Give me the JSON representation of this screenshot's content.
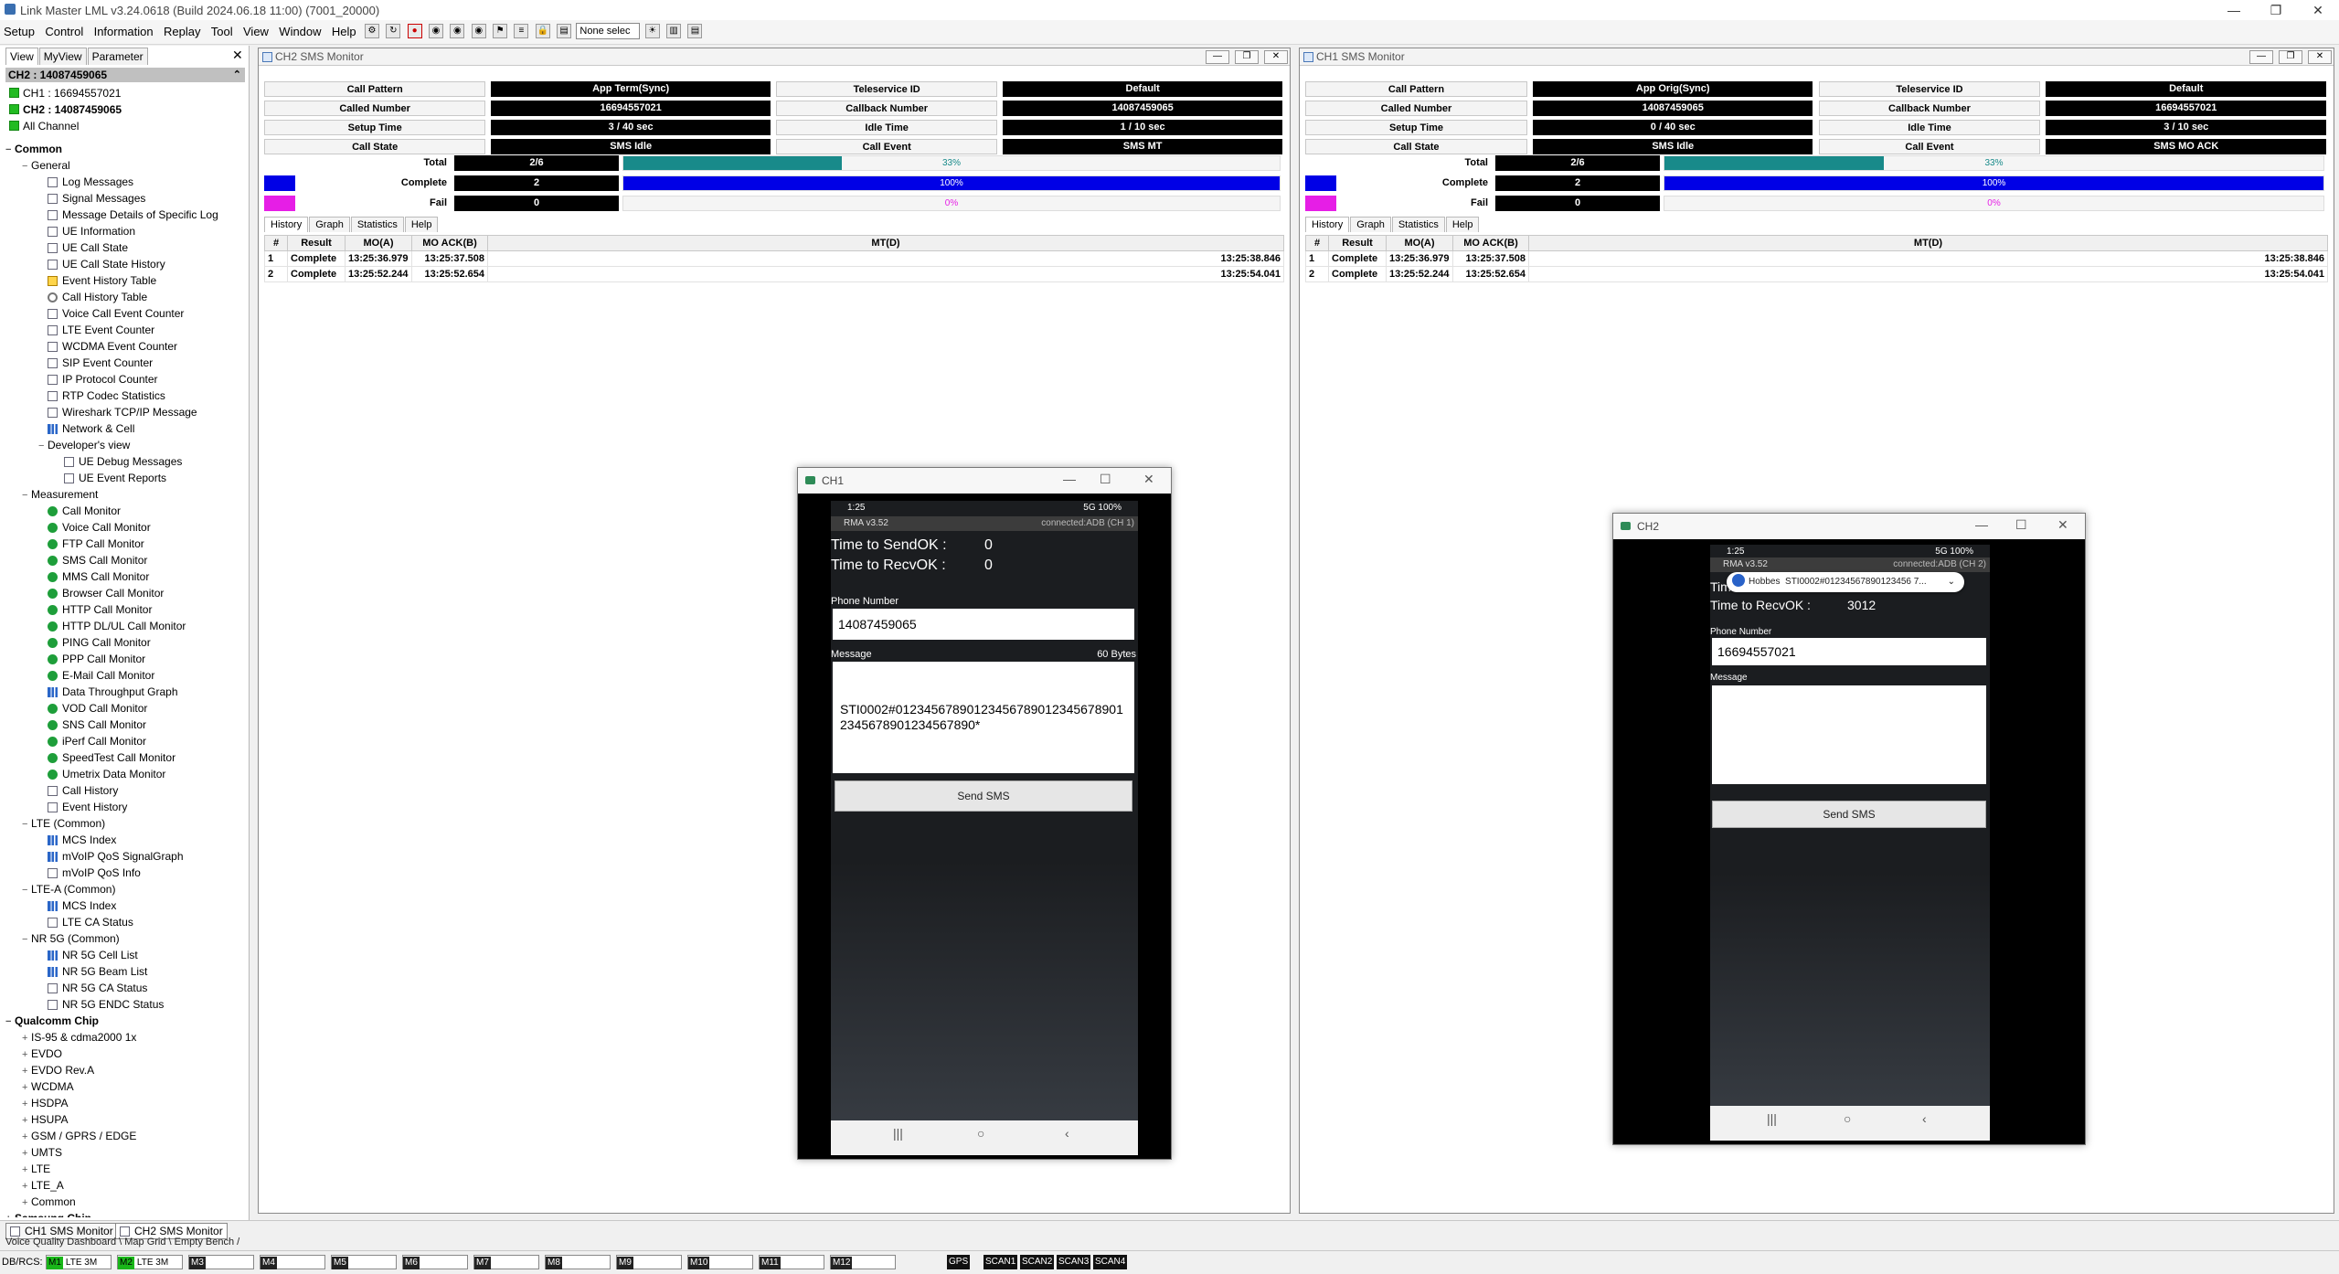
{
  "app": {
    "title": "Link Master LML v3.24.0618 (Build 2024.06.18 11:00) (7001_20000)"
  },
  "menu": [
    "Setup",
    "Control",
    "Information",
    "Replay",
    "Tool",
    "View",
    "Window",
    "Help"
  ],
  "toolbar": {
    "select_value": "None selec"
  },
  "left": {
    "tabs": [
      "View",
      "MyView",
      "Parameter"
    ],
    "close": "✕",
    "channel_header": "CH2 : 14087459065",
    "channels": [
      "CH1 : 16694557021",
      "CH2 : 14087459065",
      "All Channel"
    ]
  },
  "tree": [
    {
      "label": "Common",
      "level": 0,
      "exp": "−",
      "bold": true,
      "icon": "none"
    },
    {
      "label": "General",
      "level": 1,
      "exp": "−",
      "icon": "none"
    },
    {
      "label": "Log Messages",
      "level": 2,
      "icon": "doc"
    },
    {
      "label": "Signal Messages",
      "level": 2,
      "icon": "doc"
    },
    {
      "label": "Message Details of Specific Log",
      "level": 2,
      "icon": "doc"
    },
    {
      "label": "UE Information",
      "level": 2,
      "icon": "doc"
    },
    {
      "label": "UE Call State",
      "level": 2,
      "icon": "doc"
    },
    {
      "label": "UE Call State History",
      "level": 2,
      "icon": "doc"
    },
    {
      "label": "Event History Table",
      "level": 2,
      "icon": "warn"
    },
    {
      "label": "Call History Table",
      "level": 2,
      "icon": "gear"
    },
    {
      "label": "Voice Call Event Counter",
      "level": 2,
      "icon": "doc"
    },
    {
      "label": "LTE Event Counter",
      "level": 2,
      "icon": "doc"
    },
    {
      "label": "WCDMA Event Counter",
      "level": 2,
      "icon": "doc"
    },
    {
      "label": "SIP Event Counter",
      "level": 2,
      "icon": "doc"
    },
    {
      "label": "IP Protocol Counter",
      "level": 2,
      "icon": "doc"
    },
    {
      "label": "RTP Codec Statistics",
      "level": 2,
      "icon": "doc"
    },
    {
      "label": "Wireshark TCP/IP Message",
      "level": 2,
      "icon": "doc"
    },
    {
      "label": "Network & Cell",
      "level": 2,
      "icon": "chart"
    },
    {
      "label": "Developer's view",
      "level": 2,
      "exp": "−",
      "icon": "none"
    },
    {
      "label": "UE Debug Messages",
      "level": 3,
      "icon": "doc"
    },
    {
      "label": "UE Event Reports",
      "level": 3,
      "icon": "doc"
    },
    {
      "label": "Measurement",
      "level": 1,
      "exp": "−",
      "icon": "none"
    },
    {
      "label": "Call Monitor",
      "level": 2,
      "icon": "green"
    },
    {
      "label": "Voice Call Monitor",
      "level": 2,
      "icon": "green"
    },
    {
      "label": "FTP Call Monitor",
      "level": 2,
      "icon": "green"
    },
    {
      "label": "SMS Call Monitor",
      "level": 2,
      "icon": "green"
    },
    {
      "label": "MMS Call Monitor",
      "level": 2,
      "icon": "green"
    },
    {
      "label": "Browser Call Monitor",
      "level": 2,
      "icon": "green"
    },
    {
      "label": "HTTP Call Monitor",
      "level": 2,
      "icon": "green"
    },
    {
      "label": "HTTP DL/UL Call Monitor",
      "level": 2,
      "icon": "green"
    },
    {
      "label": "PING Call Monitor",
      "level": 2,
      "icon": "green"
    },
    {
      "label": "PPP Call Monitor",
      "level": 2,
      "icon": "green"
    },
    {
      "label": "E-Mail Call Monitor",
      "level": 2,
      "icon": "green"
    },
    {
      "label": "Data Throughput Graph",
      "level": 2,
      "icon": "chart"
    },
    {
      "label": "VOD Call Monitor",
      "level": 2,
      "icon": "green"
    },
    {
      "label": "SNS Call Monitor",
      "level": 2,
      "icon": "green"
    },
    {
      "label": "iPerf Call Monitor",
      "level": 2,
      "icon": "green"
    },
    {
      "label": "SpeedTest Call Monitor",
      "level": 2,
      "icon": "green"
    },
    {
      "label": "Umetrix Data Monitor",
      "level": 2,
      "icon": "green"
    },
    {
      "label": "Call History",
      "level": 2,
      "icon": "doc"
    },
    {
      "label": "Event History",
      "level": 2,
      "icon": "doc"
    },
    {
      "label": "LTE (Common)",
      "level": 1,
      "exp": "−",
      "icon": "none"
    },
    {
      "label": "MCS Index",
      "level": 2,
      "icon": "chart"
    },
    {
      "label": "mVoIP QoS SignalGraph",
      "level": 2,
      "icon": "chart"
    },
    {
      "label": "mVoIP QoS Info",
      "level": 2,
      "icon": "doc"
    },
    {
      "label": "LTE-A (Common)",
      "level": 1,
      "exp": "−",
      "icon": "none"
    },
    {
      "label": "MCS Index",
      "level": 2,
      "icon": "chart"
    },
    {
      "label": "LTE CA Status",
      "level": 2,
      "icon": "doc"
    },
    {
      "label": "NR 5G (Common)",
      "level": 1,
      "exp": "−",
      "icon": "none"
    },
    {
      "label": "NR 5G Cell List",
      "level": 2,
      "icon": "chart"
    },
    {
      "label": "NR 5G Beam List",
      "level": 2,
      "icon": "chart"
    },
    {
      "label": "NR 5G CA Status",
      "level": 2,
      "icon": "doc"
    },
    {
      "label": "NR 5G ENDC Status",
      "level": 2,
      "icon": "doc"
    },
    {
      "label": "Qualcomm Chip",
      "level": 0,
      "exp": "−",
      "bold": true,
      "icon": "none"
    },
    {
      "label": "IS-95 & cdma2000 1x",
      "level": 1,
      "exp": "+",
      "icon": "none"
    },
    {
      "label": "EVDO",
      "level": 1,
      "exp": "+",
      "icon": "none"
    },
    {
      "label": "EVDO Rev.A",
      "level": 1,
      "exp": "+",
      "icon": "none"
    },
    {
      "label": "WCDMA",
      "level": 1,
      "exp": "+",
      "icon": "none"
    },
    {
      "label": "HSDPA",
      "level": 1,
      "exp": "+",
      "icon": "none"
    },
    {
      "label": "HSUPA",
      "level": 1,
      "exp": "+",
      "icon": "none"
    },
    {
      "label": "GSM / GPRS / EDGE",
      "level": 1,
      "exp": "+",
      "icon": "none"
    },
    {
      "label": "UMTS",
      "level": 1,
      "exp": "+",
      "icon": "none"
    },
    {
      "label": "LTE",
      "level": 1,
      "exp": "+",
      "icon": "none"
    },
    {
      "label": "LTE_A",
      "level": 1,
      "exp": "+",
      "icon": "none"
    },
    {
      "label": "Common",
      "level": 1,
      "exp": "+",
      "icon": "none"
    },
    {
      "label": "Samsung Chip",
      "level": 0,
      "exp": "+",
      "bold": true,
      "icon": "none"
    }
  ],
  "bottom": {
    "tabs": [
      "CH1 SMS Monitor",
      "CH2 SMS Monitor"
    ],
    "subtabs": "Voice Quality Dashboard \\ Map Grid \\ Empty Bench /"
  },
  "status": {
    "prefix": "DB/RCS:",
    "boxes": [
      {
        "label": "M1",
        "txt": "LTE   3M",
        "on": true
      },
      {
        "label": "M2",
        "txt": "LTE   3M",
        "on": true
      },
      {
        "label": "M3",
        "txt": "",
        "on": false
      },
      {
        "label": "M4",
        "txt": "",
        "on": false
      },
      {
        "label": "M5",
        "txt": "",
        "on": false
      },
      {
        "label": "M6",
        "txt": "",
        "on": false
      },
      {
        "label": "M7",
        "txt": "",
        "on": false
      },
      {
        "label": "M8",
        "txt": "",
        "on": false
      },
      {
        "label": "M9",
        "txt": "",
        "on": false
      },
      {
        "label": "M10",
        "txt": "",
        "on": false
      },
      {
        "label": "M11",
        "txt": "",
        "on": false
      },
      {
        "label": "M12",
        "txt": "",
        "on": false
      }
    ],
    "scans": [
      "GPS",
      "SCAN1",
      "SCAN2",
      "SCAN3",
      "SCAN4"
    ]
  },
  "monitors": [
    {
      "title": "CH2 SMS Monitor",
      "rows": [
        [
          "Call Pattern",
          "App Term(Sync)",
          "Teleservice ID",
          "Default"
        ],
        [
          "Called Number",
          "16694557021",
          "Callback Number",
          "14087459065"
        ],
        [
          "Setup Time",
          "3 / 40 sec",
          "Idle Time",
          "1 / 10 sec"
        ],
        [
          "Call State",
          "SMS Idle",
          "Call Event",
          "SMS MT"
        ]
      ],
      "stats": [
        {
          "name": "Total",
          "count": "2/6",
          "pct": "33%",
          "fraction": 0.333,
          "color": "#188a8a",
          "textcolor": "#188a8a",
          "swatch": ""
        },
        {
          "name": "Complete",
          "count": "2",
          "pct": "100%",
          "fraction": 1.0,
          "color": "#0000e6",
          "textcolor": "#ffffff",
          "swatch": "#0000e6"
        },
        {
          "name": "Fail",
          "count": "0",
          "pct": "0%",
          "fraction": 0.0,
          "color": "#e61ee6",
          "textcolor": "#e61ee6",
          "swatch": "#e61ee6"
        }
      ],
      "tabs": [
        "History",
        "Graph",
        "Statistics",
        "Help"
      ],
      "columns": [
        "#",
        "Result",
        "MO(A)",
        "MO ACK(B)",
        "MT(D)"
      ],
      "history": [
        [
          "1",
          "Complete",
          "13:25:36.979",
          "13:25:37.508",
          "13:25:38.846"
        ],
        [
          "2",
          "Complete",
          "13:25:52.244",
          "13:25:52.654",
          "13:25:54.041"
        ]
      ]
    },
    {
      "title": "CH1 SMS Monitor",
      "rows": [
        [
          "Call Pattern",
          "App Orig(Sync)",
          "Teleservice ID",
          "Default"
        ],
        [
          "Called Number",
          "14087459065",
          "Callback Number",
          "16694557021"
        ],
        [
          "Setup Time",
          "0 / 40 sec",
          "Idle Time",
          "3 / 10 sec"
        ],
        [
          "Call State",
          "SMS Idle",
          "Call Event",
          "SMS MO ACK"
        ]
      ],
      "stats": [
        {
          "name": "Total",
          "count": "2/6",
          "pct": "33%",
          "fraction": 0.333,
          "color": "#188a8a",
          "textcolor": "#188a8a",
          "swatch": ""
        },
        {
          "name": "Complete",
          "count": "2",
          "pct": "100%",
          "fraction": 1.0,
          "color": "#0000e6",
          "textcolor": "#ffffff",
          "swatch": "#0000e6"
        },
        {
          "name": "Fail",
          "count": "0",
          "pct": "0%",
          "fraction": 0.0,
          "color": "#e61ee6",
          "textcolor": "#e61ee6",
          "swatch": "#e61ee6"
        }
      ],
      "tabs": [
        "History",
        "Graph",
        "Statistics",
        "Help"
      ],
      "columns": [
        "#",
        "Result",
        "MO(A)",
        "MO ACK(B)",
        "MT(D)"
      ],
      "history": [
        [
          "1",
          "Complete",
          "13:25:36.979",
          "13:25:37.508",
          "13:25:38.846"
        ],
        [
          "2",
          "Complete",
          "13:25:52.244",
          "13:25:52.654",
          "13:25:54.041"
        ]
      ]
    }
  ],
  "phone1": {
    "window_title": "CH1",
    "status_left": "1:25",
    "status_right": "5G  100%",
    "app_name": "RMA v3.52",
    "app_status": "connected:ADB (CH 1)",
    "send_label": "Time to SendOK :",
    "send_value": "0",
    "recv_label": "Time to RecvOK :",
    "recv_value": "0",
    "phone_label": "Phone Number",
    "phone_value": "14087459065",
    "message_label": "Message",
    "message_bytes": "60 Bytes",
    "message_value": "STI0002#012345678901234567890123456789012345678901234567890*",
    "button": "Send SMS"
  },
  "phone2": {
    "window_title": "CH2",
    "status_left": "1:25",
    "status_right": "5G  100%",
    "app_name": "RMA v3.52",
    "app_status": "connected:ADB (CH 2)",
    "send_label": "Tim",
    "recv_label": "Time to RecvOK :",
    "recv_value": "3012",
    "notif_app": "Hobbes",
    "notif_text": "STI0002#01234567890123456 7...",
    "phone_label": "Phone Number",
    "phone_value": "16694557021",
    "message_label": "Message",
    "button": "Send SMS"
  }
}
